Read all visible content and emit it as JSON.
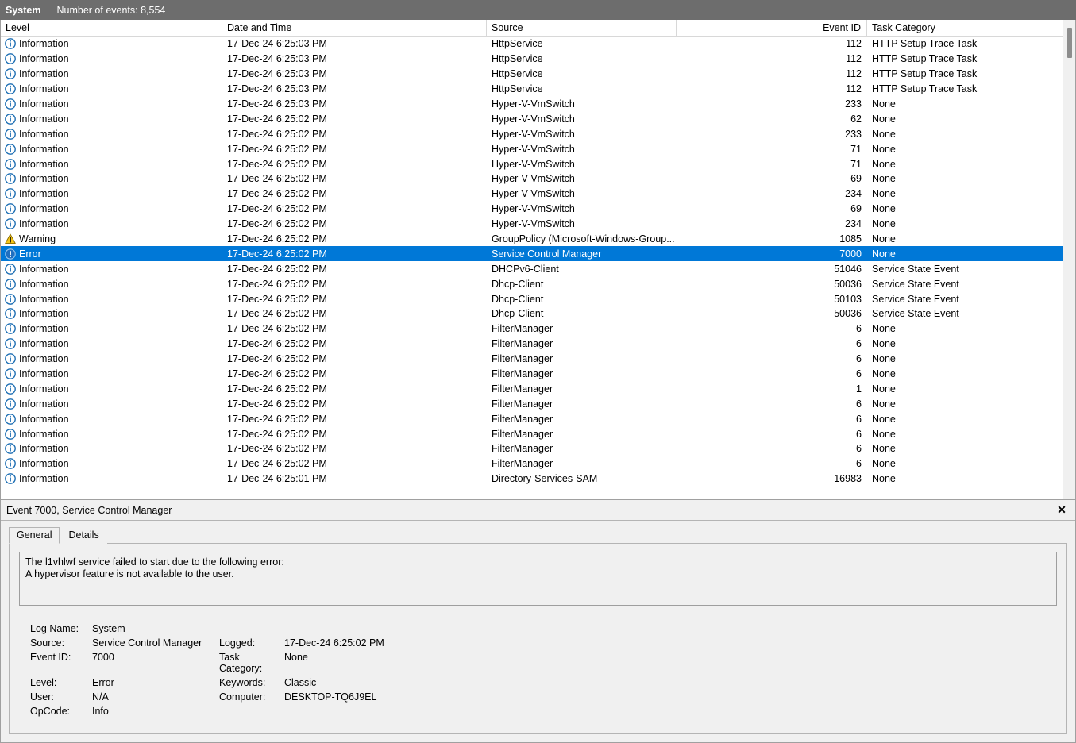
{
  "titlebar": {
    "log_name": "System",
    "events_label": "Number of events: 8,554"
  },
  "columns": {
    "level": "Level",
    "date": "Date and Time",
    "source": "Source",
    "event_id": "Event ID",
    "task_category": "Task Category"
  },
  "icons": {
    "information": "information-icon",
    "warning": "warning-icon",
    "error": "error-icon",
    "close": "close-icon"
  },
  "colors": {
    "selection": "#0078d7",
    "titlebar": "#6d6d6d",
    "info_icon": "#1e6fb4",
    "warning_icon": "#f5c518",
    "error_icon": "#8b1a1a",
    "panel": "#f0f0f0"
  },
  "rows": [
    {
      "level": "Information",
      "icon": "information",
      "date": "17-Dec-24 6:25:03 PM",
      "source": "HttpService",
      "event_id": "112",
      "category": "HTTP Setup Trace Task",
      "selected": false
    },
    {
      "level": "Information",
      "icon": "information",
      "date": "17-Dec-24 6:25:03 PM",
      "source": "HttpService",
      "event_id": "112",
      "category": "HTTP Setup Trace Task",
      "selected": false
    },
    {
      "level": "Information",
      "icon": "information",
      "date": "17-Dec-24 6:25:03 PM",
      "source": "HttpService",
      "event_id": "112",
      "category": "HTTP Setup Trace Task",
      "selected": false
    },
    {
      "level": "Information",
      "icon": "information",
      "date": "17-Dec-24 6:25:03 PM",
      "source": "HttpService",
      "event_id": "112",
      "category": "HTTP Setup Trace Task",
      "selected": false
    },
    {
      "level": "Information",
      "icon": "information",
      "date": "17-Dec-24 6:25:03 PM",
      "source": "Hyper-V-VmSwitch",
      "event_id": "233",
      "category": "None",
      "selected": false
    },
    {
      "level": "Information",
      "icon": "information",
      "date": "17-Dec-24 6:25:02 PM",
      "source": "Hyper-V-VmSwitch",
      "event_id": "62",
      "category": "None",
      "selected": false
    },
    {
      "level": "Information",
      "icon": "information",
      "date": "17-Dec-24 6:25:02 PM",
      "source": "Hyper-V-VmSwitch",
      "event_id": "233",
      "category": "None",
      "selected": false
    },
    {
      "level": "Information",
      "icon": "information",
      "date": "17-Dec-24 6:25:02 PM",
      "source": "Hyper-V-VmSwitch",
      "event_id": "71",
      "category": "None",
      "selected": false
    },
    {
      "level": "Information",
      "icon": "information",
      "date": "17-Dec-24 6:25:02 PM",
      "source": "Hyper-V-VmSwitch",
      "event_id": "71",
      "category": "None",
      "selected": false
    },
    {
      "level": "Information",
      "icon": "information",
      "date": "17-Dec-24 6:25:02 PM",
      "source": "Hyper-V-VmSwitch",
      "event_id": "69",
      "category": "None",
      "selected": false
    },
    {
      "level": "Information",
      "icon": "information",
      "date": "17-Dec-24 6:25:02 PM",
      "source": "Hyper-V-VmSwitch",
      "event_id": "234",
      "category": "None",
      "selected": false
    },
    {
      "level": "Information",
      "icon": "information",
      "date": "17-Dec-24 6:25:02 PM",
      "source": "Hyper-V-VmSwitch",
      "event_id": "69",
      "category": "None",
      "selected": false
    },
    {
      "level": "Information",
      "icon": "information",
      "date": "17-Dec-24 6:25:02 PM",
      "source": "Hyper-V-VmSwitch",
      "event_id": "234",
      "category": "None",
      "selected": false
    },
    {
      "level": "Warning",
      "icon": "warning",
      "date": "17-Dec-24 6:25:02 PM",
      "source": "GroupPolicy (Microsoft-Windows-Group...",
      "event_id": "1085",
      "category": "None",
      "selected": false
    },
    {
      "level": "Error",
      "icon": "error",
      "date": "17-Dec-24 6:25:02 PM",
      "source": "Service Control Manager",
      "event_id": "7000",
      "category": "None",
      "selected": true
    },
    {
      "level": "Information",
      "icon": "information",
      "date": "17-Dec-24 6:25:02 PM",
      "source": "DHCPv6-Client",
      "event_id": "51046",
      "category": "Service State Event",
      "selected": false
    },
    {
      "level": "Information",
      "icon": "information",
      "date": "17-Dec-24 6:25:02 PM",
      "source": "Dhcp-Client",
      "event_id": "50036",
      "category": "Service State Event",
      "selected": false
    },
    {
      "level": "Information",
      "icon": "information",
      "date": "17-Dec-24 6:25:02 PM",
      "source": "Dhcp-Client",
      "event_id": "50103",
      "category": "Service State Event",
      "selected": false
    },
    {
      "level": "Information",
      "icon": "information",
      "date": "17-Dec-24 6:25:02 PM",
      "source": "Dhcp-Client",
      "event_id": "50036",
      "category": "Service State Event",
      "selected": false
    },
    {
      "level": "Information",
      "icon": "information",
      "date": "17-Dec-24 6:25:02 PM",
      "source": "FilterManager",
      "event_id": "6",
      "category": "None",
      "selected": false
    },
    {
      "level": "Information",
      "icon": "information",
      "date": "17-Dec-24 6:25:02 PM",
      "source": "FilterManager",
      "event_id": "6",
      "category": "None",
      "selected": false
    },
    {
      "level": "Information",
      "icon": "information",
      "date": "17-Dec-24 6:25:02 PM",
      "source": "FilterManager",
      "event_id": "6",
      "category": "None",
      "selected": false
    },
    {
      "level": "Information",
      "icon": "information",
      "date": "17-Dec-24 6:25:02 PM",
      "source": "FilterManager",
      "event_id": "6",
      "category": "None",
      "selected": false
    },
    {
      "level": "Information",
      "icon": "information",
      "date": "17-Dec-24 6:25:02 PM",
      "source": "FilterManager",
      "event_id": "1",
      "category": "None",
      "selected": false
    },
    {
      "level": "Information",
      "icon": "information",
      "date": "17-Dec-24 6:25:02 PM",
      "source": "FilterManager",
      "event_id": "6",
      "category": "None",
      "selected": false
    },
    {
      "level": "Information",
      "icon": "information",
      "date": "17-Dec-24 6:25:02 PM",
      "source": "FilterManager",
      "event_id": "6",
      "category": "None",
      "selected": false
    },
    {
      "level": "Information",
      "icon": "information",
      "date": "17-Dec-24 6:25:02 PM",
      "source": "FilterManager",
      "event_id": "6",
      "category": "None",
      "selected": false
    },
    {
      "level": "Information",
      "icon": "information",
      "date": "17-Dec-24 6:25:02 PM",
      "source": "FilterManager",
      "event_id": "6",
      "category": "None",
      "selected": false
    },
    {
      "level": "Information",
      "icon": "information",
      "date": "17-Dec-24 6:25:02 PM",
      "source": "FilterManager",
      "event_id": "6",
      "category": "None",
      "selected": false
    },
    {
      "level": "Information",
      "icon": "information",
      "date": "17-Dec-24 6:25:01 PM",
      "source": "Directory-Services-SAM",
      "event_id": "16983",
      "category": "None",
      "selected": false
    }
  ],
  "detail": {
    "header_title": "Event 7000, Service Control Manager",
    "close_label": "✕",
    "tabs": [
      {
        "label": "General",
        "active": true
      },
      {
        "label": "Details",
        "active": false
      }
    ],
    "description_line1": "The l1vhlwf service failed to start due to the following error:",
    "description_line2": "A hypervisor feature is not available to the user.",
    "meta": {
      "log_name_label": "Log Name:",
      "log_name_value": "System",
      "source_label": "Source:",
      "source_value": "Service Control Manager",
      "logged_label": "Logged:",
      "logged_value": "17-Dec-24 6:25:02 PM",
      "event_id_label": "Event ID:",
      "event_id_value": "7000",
      "task_category_label": "Task Category:",
      "task_category_value": "None",
      "level_label": "Level:",
      "level_value": "Error",
      "keywords_label": "Keywords:",
      "keywords_value": "Classic",
      "user_label": "User:",
      "user_value": "N/A",
      "computer_label": "Computer:",
      "computer_value": "DESKTOP-TQ6J9EL",
      "opcode_label": "OpCode:",
      "opcode_value": "Info"
    }
  }
}
